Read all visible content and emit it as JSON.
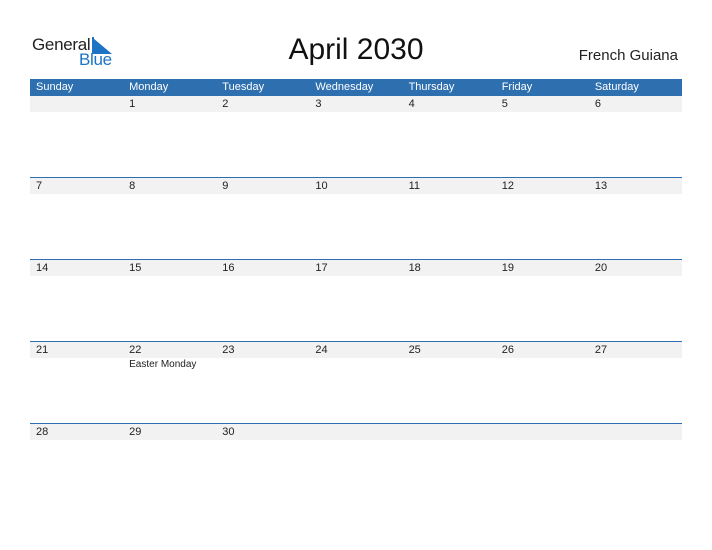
{
  "logo": {
    "line1": "General",
    "line2": "Blue"
  },
  "title": "April 2030",
  "region": "French Guiana",
  "colors": {
    "header_bg": "#2e6fb0",
    "brand_blue": "#1d74c5",
    "date_row_bg": "#f2f2f2"
  },
  "weekdays": [
    "Sunday",
    "Monday",
    "Tuesday",
    "Wednesday",
    "Thursday",
    "Friday",
    "Saturday"
  ],
  "weeks": [
    {
      "days": [
        "",
        "1",
        "2",
        "3",
        "4",
        "5",
        "6"
      ],
      "notes": [
        "",
        "",
        "",
        "",
        "",
        "",
        ""
      ]
    },
    {
      "days": [
        "7",
        "8",
        "9",
        "10",
        "11",
        "12",
        "13"
      ],
      "notes": [
        "",
        "",
        "",
        "",
        "",
        "",
        ""
      ]
    },
    {
      "days": [
        "14",
        "15",
        "16",
        "17",
        "18",
        "19",
        "20"
      ],
      "notes": [
        "",
        "",
        "",
        "",
        "",
        "",
        ""
      ]
    },
    {
      "days": [
        "21",
        "22",
        "23",
        "24",
        "25",
        "26",
        "27"
      ],
      "notes": [
        "",
        "Easter Monday",
        "",
        "",
        "",
        "",
        ""
      ]
    },
    {
      "days": [
        "28",
        "29",
        "30",
        "",
        "",
        "",
        ""
      ],
      "notes": [
        "",
        "",
        "",
        "",
        "",
        "",
        ""
      ]
    }
  ]
}
